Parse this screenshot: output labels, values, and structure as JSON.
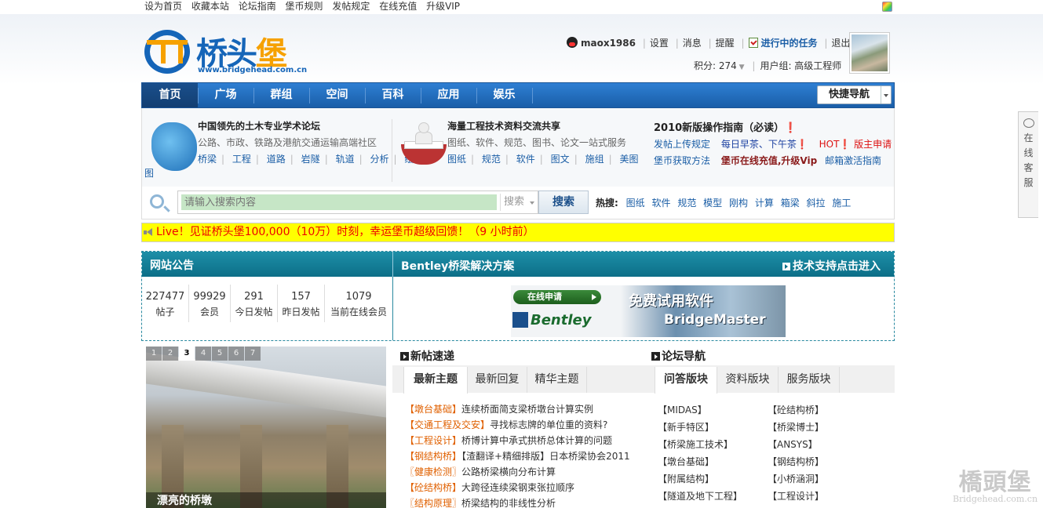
{
  "topbar": {
    "links": [
      "设为首页",
      "收藏本站",
      "论坛指南",
      "堡币规则",
      "发帖规定",
      "在线充值",
      "升级VIP"
    ]
  },
  "logo": {
    "text_a": "桥头",
    "text_b": "堡",
    "url": "www.bridgehead.com.cn"
  },
  "user": {
    "name": "maox1986",
    "settings": "设置",
    "messages": "消息",
    "reminders": "提醒",
    "tasks": "进行中的任务",
    "logout": "退出",
    "credits_label": "积分: 274",
    "usergroup": "用户组: 高级工程师"
  },
  "nav": {
    "items": [
      "首页",
      "广场",
      "群组",
      "空间",
      "百科",
      "应用",
      "娱乐"
    ],
    "quick": "快捷导航"
  },
  "promo": {
    "col1": {
      "title": "中国领先的土木专业学术论坛",
      "sub": "公路、市政、铁路及港航交通运输高端社区",
      "links": [
        "桥梁",
        "工程",
        "道路",
        "岩隧",
        "轨道",
        "分析",
        "绘"
      ],
      "tail": "图"
    },
    "col2": {
      "title": "海量工程技术资料交流共享",
      "sub": "图纸、软件、规范、图书、论文一站式服务",
      "links": [
        "图纸",
        "规范",
        "软件",
        "图文",
        "施组",
        "美图"
      ]
    },
    "col3": {
      "title": "2010新版操作指南（必读）❗",
      "row1": [
        "发帖上传规定",
        "每日早茶、下午茶❗",
        "HOT❗ 版主申请"
      ],
      "row2": [
        "堡币获取方法",
        "堡币在线充值,升级Vip",
        "邮箱激活指南"
      ]
    }
  },
  "search": {
    "placeholder": "请输入搜索内容",
    "scope": "搜索",
    "button": "搜索",
    "hot_label": "热搜:",
    "hot": [
      "图纸",
      "软件",
      "规范",
      "模型",
      "刚构",
      "计算",
      "箱梁",
      "斜拉",
      "施工"
    ]
  },
  "live": {
    "text": "Live！见证桥头堡100,000（10万）时刻，幸运堡币超级回馈！（9 小时前）"
  },
  "panel": {
    "notice_title": "网站公告",
    "solution_title": "Bentley桥梁解决方案",
    "support_title": "技术支持点击进入",
    "stats": [
      {
        "n": "227477",
        "l": "帖子"
      },
      {
        "n": "99929",
        "l": "会员"
      },
      {
        "n": "291",
        "l": "今日发帖"
      },
      {
        "n": "157",
        "l": "昨日发帖"
      },
      {
        "n": "1079",
        "l": "当前在线会员"
      }
    ],
    "banner": {
      "apply": "在线申请",
      "free": "免费试用软件",
      "product": "BridgeMaster",
      "brand": "Bentley"
    }
  },
  "slider": {
    "pages": [
      "1",
      "2",
      "3",
      "4",
      "5",
      "6",
      "7"
    ],
    "active": 3,
    "caption": "漂亮的桥墩"
  },
  "new_posts": {
    "title": "新帖速递",
    "tabs": [
      "最新主题",
      "最新回复",
      "精华主题"
    ],
    "items": [
      {
        "tag": "【墩台基础】",
        "title": "连续桥面简支梁桥墩台计算实例"
      },
      {
        "tag": "【交通工程及交安】",
        "title": "寻找标志牌的单位重的资料?"
      },
      {
        "tag": "【工程设计】",
        "title": "桥博计算中承式拱桥总体计算的问题"
      },
      {
        "tag": "【钢结构桥】",
        "title": "【渣翻译+精细排版】日本桥梁协会2011"
      },
      {
        "tag": "〖健康检测〗",
        "title": "公路桥梁横向分布计算"
      },
      {
        "tag": "【砼结构桥】",
        "title": "大跨径连续梁钢束张拉顺序"
      },
      {
        "tag": "〖结构原理〗",
        "title": "桥梁结构的非线性分析"
      }
    ]
  },
  "forum_nav": {
    "title": "论坛导航",
    "tabs": [
      "问答版块",
      "资料版块",
      "服务版块"
    ],
    "col1": [
      "【MIDAS】",
      "【新手特区】",
      "【桥梁施工技术】",
      "【墩台基础】",
      "【附属结构】",
      "【隧道及地下工程】"
    ],
    "col2": [
      "【砼结构桥】",
      "【桥梁博士】",
      "【ANSYS】",
      "【钢结构桥】",
      "【小桥涵洞】",
      "【工程设计】"
    ]
  },
  "side": {
    "chars": [
      "在",
      "线",
      "客",
      "服"
    ]
  },
  "watermark": {
    "a": "橋頭堡",
    "b": "Bridgehead.com.cn"
  }
}
